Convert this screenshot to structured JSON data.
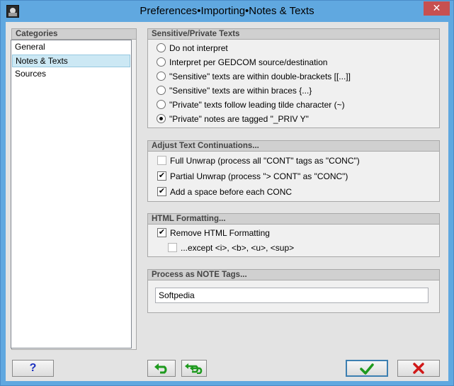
{
  "window": {
    "title": "Preferences•Importing•Notes & Texts",
    "close_glyph": "✕"
  },
  "categories": {
    "header": "Categories",
    "items": [
      {
        "label": "General",
        "selected": false
      },
      {
        "label": "Notes & Texts",
        "selected": true
      },
      {
        "label": "Sources",
        "selected": false
      }
    ]
  },
  "sensitive": {
    "header": "Sensitive/Private Texts",
    "options": [
      {
        "label": "Do not interpret",
        "checked": false
      },
      {
        "label": "Interpret per GEDCOM source/destination",
        "checked": false
      },
      {
        "label": "\"Sensitive\" texts are within double-brackets [[...]]",
        "checked": false
      },
      {
        "label": "\"Sensitive\" texts are within braces {...}",
        "checked": false
      },
      {
        "label": "\"Private\" texts follow leading tilde character (~)",
        "checked": false
      },
      {
        "label": "\"Private\" notes are tagged \"_PRIV Y\"",
        "checked": true
      }
    ]
  },
  "continuations": {
    "header": "Adjust Text Continuations...",
    "options": [
      {
        "label": "Full Unwrap (process all \"CONT\" tags as \"CONC\")",
        "checked": false
      },
      {
        "label": "Partial Unwrap (process \"> CONT\" as \"CONC\")",
        "checked": true
      },
      {
        "label": "Add a space before each CONC",
        "checked": true
      }
    ]
  },
  "html": {
    "header": "HTML Formatting...",
    "remove": {
      "label": "Remove HTML Formatting",
      "checked": true
    },
    "except": {
      "label": "...except <i>, <b>, <u>, <sup>",
      "checked": false
    }
  },
  "note_tags": {
    "header": "Process as NOTE Tags...",
    "value": "Softpedia"
  },
  "buttons": {
    "help": "?",
    "check_mark": "✔",
    "colors": {
      "help": "#1a2fbf",
      "green": "#1e9a1e",
      "red": "#d01818"
    }
  }
}
